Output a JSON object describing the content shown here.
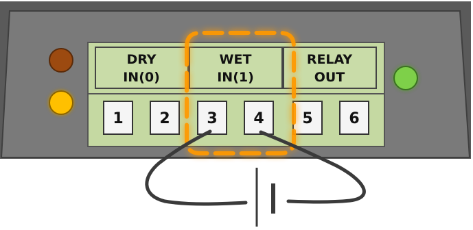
{
  "device": {
    "groups": [
      {
        "line1": "DRY",
        "line2": "IN(0)"
      },
      {
        "line1": "WET",
        "line2": "IN(1)"
      },
      {
        "line1": "RELAY",
        "line2": "OUT"
      }
    ],
    "terminals": [
      "1",
      "2",
      "3",
      "4",
      "5",
      "6"
    ],
    "highlighted_terminals": [
      "3",
      "4"
    ]
  },
  "colors": {
    "housing": "#7a7a7a",
    "housing_edge": "#4a4a4a",
    "header_green": "#c9dca8",
    "terminal_green": "#c5d9a2",
    "led_brown": "#9c4a10",
    "led_amber": "#ffc000",
    "led_green": "#7ed04a",
    "highlight_orange": "#ff9900",
    "wire": "#3a3a3a"
  }
}
